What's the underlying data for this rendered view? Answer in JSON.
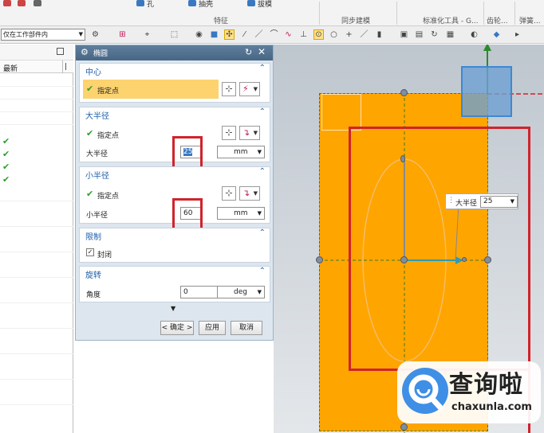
{
  "ribbon": {
    "items": [
      "孔",
      "抽壳",
      "拔模"
    ],
    "groups": [
      "特征",
      "同步建模",
      "标准化工具 - G...",
      "齿轮...",
      "弹簧..."
    ]
  },
  "toolbar": {
    "filter_value": "仅在工作部件内"
  },
  "navigator": {
    "column_header": "最新",
    "checked_rows": 4
  },
  "dialog": {
    "title": "椭圆",
    "center": {
      "title": "中心",
      "specify_point": "指定点"
    },
    "major_radius": {
      "title": "大半径",
      "specify_point": "指定点",
      "field_label": "大半径",
      "value": "25",
      "unit": "mm"
    },
    "minor_radius": {
      "title": "小半径",
      "specify_point": "指定点",
      "field_label": "小半径",
      "value": "60",
      "unit": "mm"
    },
    "limits": {
      "title": "限制",
      "closed_label": "封闭",
      "closed_checked": true
    },
    "rotation": {
      "title": "旋转",
      "angle_label": "角度",
      "value": "0",
      "unit": "deg"
    },
    "buttons": {
      "ok": "< 确定 >",
      "apply": "应用",
      "cancel": "取消"
    }
  },
  "viewport": {
    "tooltip_label": "大半径",
    "tooltip_value": "25"
  },
  "watermark": {
    "name": "查询啦",
    "url": "chaxunla.com"
  },
  "colors": {
    "body_fill": "#ffa500",
    "highlight_red": "#d0232c",
    "dialog_header": "#4e6e8e",
    "section_title": "#1f5fa8"
  }
}
